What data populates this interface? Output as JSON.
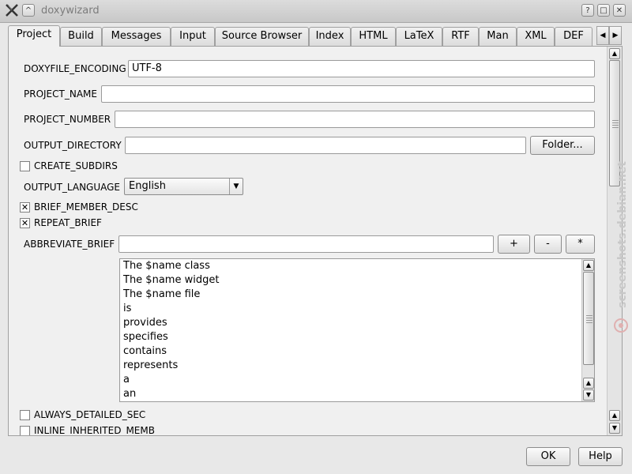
{
  "window": {
    "title": "doxywizard",
    "help_btn": "?",
    "max_btn": "□",
    "close_btn": "✕",
    "shade_btn": "^"
  },
  "tabs": [
    "Project",
    "Build",
    "Messages",
    "Input",
    "Source Browser",
    "Index",
    "HTML",
    "LaTeX",
    "RTF",
    "Man",
    "XML",
    "DEF"
  ],
  "project": {
    "doxyfile_encoding": {
      "label": "DOXYFILE_ENCODING",
      "value": "UTF-8"
    },
    "project_name": {
      "label": "PROJECT_NAME",
      "value": ""
    },
    "project_number": {
      "label": "PROJECT_NUMBER",
      "value": ""
    },
    "output_directory": {
      "label": "OUTPUT_DIRECTORY",
      "value": "",
      "button": "Folder..."
    },
    "create_subdirs": {
      "label": "CREATE_SUBDIRS",
      "checked": false
    },
    "output_language": {
      "label": "OUTPUT_LANGUAGE",
      "value": "English"
    },
    "brief_member_desc": {
      "label": "BRIEF_MEMBER_DESC",
      "checked": true,
      "mark": "✕"
    },
    "repeat_brief": {
      "label": "REPEAT_BRIEF",
      "checked": true,
      "mark": "✕"
    },
    "abbreviate_brief": {
      "label": "ABBREVIATE_BRIEF",
      "value": "",
      "add": "+",
      "remove": "-",
      "edit": "*",
      "items": [
        "The $name class",
        "The $name widget",
        "The $name file",
        "is",
        "provides",
        "specifies",
        "contains",
        "represents",
        "a",
        "an"
      ]
    },
    "always_detailed_sec": {
      "label": "ALWAYS_DETAILED_SEC",
      "checked": false
    },
    "inline_inherited_memb": {
      "label": "INLINE_INHERITED_MEMB",
      "checked": false
    }
  },
  "footer": {
    "ok": "OK",
    "help": "Help"
  },
  "watermark": "screenshots.debian.net"
}
